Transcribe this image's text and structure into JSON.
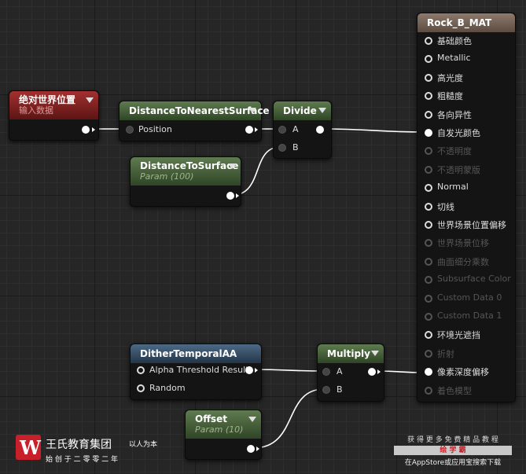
{
  "nodes": {
    "abs_pos": {
      "title": "绝对世界位置",
      "sub": "输入数据"
    },
    "dist_nearest": {
      "title": "DistanceToNearestSurface",
      "pin_position": "Position"
    },
    "divide": {
      "title": "Divide",
      "pin_a": "A",
      "pin_b": "B"
    },
    "dist_surface": {
      "title": "DistanceToSurface",
      "sub": "Param (100)"
    },
    "dither": {
      "title": "DitherTemporalAA",
      "pin_alpha": "Alpha Threshold Result",
      "pin_random": "Random"
    },
    "multiply": {
      "title": "Multiply",
      "pin_a": "A",
      "pin_b": "B"
    },
    "offset": {
      "title": "Offset",
      "sub": "Param (10)"
    }
  },
  "material": {
    "title": "Rock_B_MAT",
    "pins": [
      {
        "label": "基础颜色",
        "enabled": true,
        "connected": false
      },
      {
        "label": "Metallic",
        "enabled": true,
        "connected": false
      },
      {
        "label": "高光度",
        "enabled": true,
        "connected": false
      },
      {
        "label": "粗糙度",
        "enabled": true,
        "connected": false
      },
      {
        "label": "各向异性",
        "enabled": true,
        "connected": false
      },
      {
        "label": "自发光颜色",
        "enabled": true,
        "connected": true
      },
      {
        "label": "不透明度",
        "enabled": false,
        "connected": false
      },
      {
        "label": "不透明蒙版",
        "enabled": false,
        "connected": false
      },
      {
        "label": "Normal",
        "enabled": true,
        "connected": false
      },
      {
        "label": "切线",
        "enabled": true,
        "connected": false
      },
      {
        "label": "世界场景位置偏移",
        "enabled": true,
        "connected": false
      },
      {
        "label": "世界场景位移",
        "enabled": false,
        "connected": false
      },
      {
        "label": "曲面细分乘数",
        "enabled": false,
        "connected": false
      },
      {
        "label": "Subsurface Color",
        "enabled": false,
        "connected": false
      },
      {
        "label": "Custom Data 0",
        "enabled": false,
        "connected": false
      },
      {
        "label": "Custom Data 1",
        "enabled": false,
        "connected": false
      },
      {
        "label": "环境光遮挡",
        "enabled": true,
        "connected": false
      },
      {
        "label": "折射",
        "enabled": false,
        "connected": false
      },
      {
        "label": "像素深度偏移",
        "enabled": true,
        "connected": true
      },
      {
        "label": "着色模型",
        "enabled": false,
        "connected": false
      }
    ]
  },
  "logo": {
    "name": "王氏教育集团",
    "slogan": "以人为本",
    "motto": "始 创 于 二 零 零 二 年",
    "mark": "W"
  },
  "promo": {
    "line1": "获 得 更 多 免 费 精 品 教 程",
    "button": "绘 学 霸",
    "line2": "在AppStore或应用宝搜索下载"
  },
  "colors": {
    "wire": "#ffffff",
    "grid": "#262626",
    "header_green": "#5f7b50",
    "header_red": "#a33030",
    "header_blue": "#4d6a85",
    "header_brown": "#8e7a6c"
  }
}
